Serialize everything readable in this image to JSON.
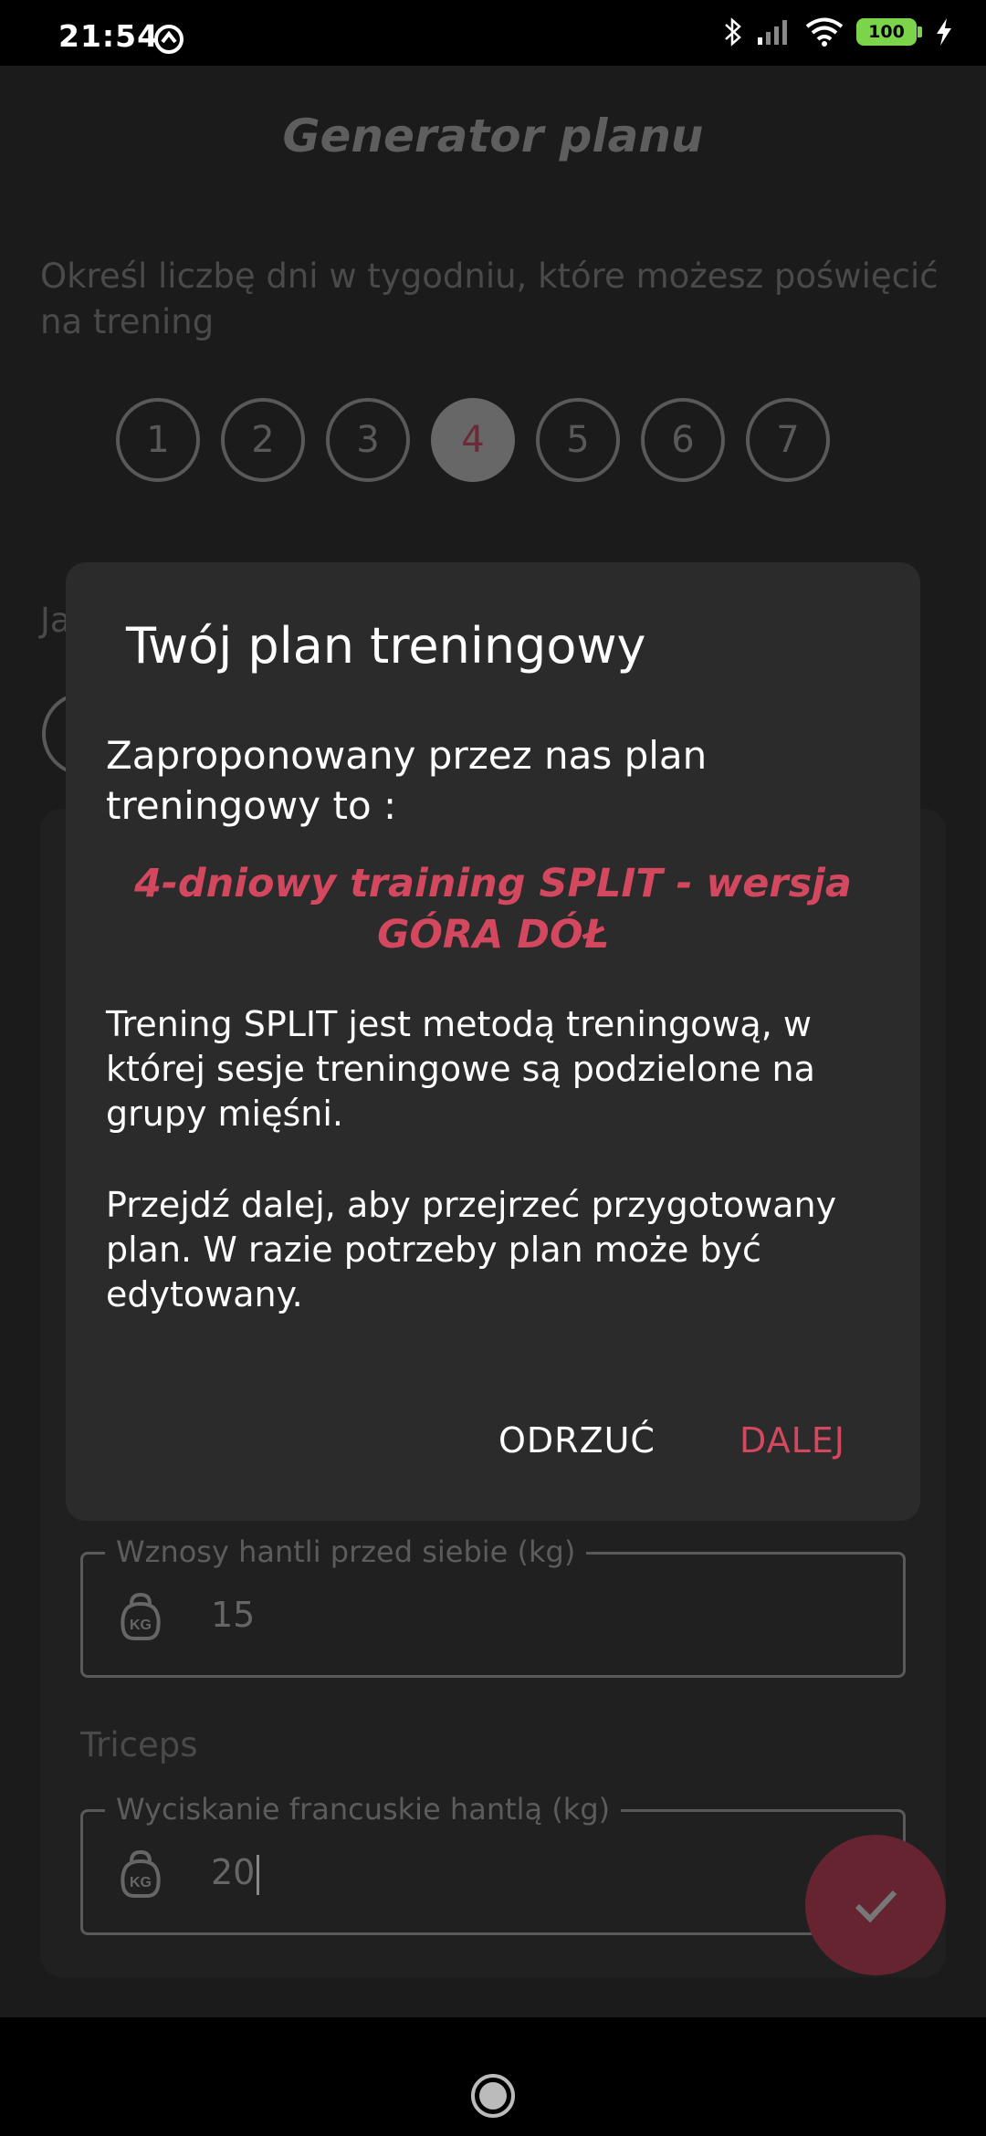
{
  "status_bar": {
    "time": "21:54",
    "battery": "100",
    "icons": [
      "app-notification-icon",
      "bluetooth-icon",
      "signal-icon",
      "wifi-icon",
      "battery-icon",
      "charging-icon"
    ]
  },
  "page": {
    "title": "Generator planu",
    "description": "Określ liczbę dni w tygodniu, które możesz poświęcić na trening",
    "days": [
      "1",
      "2",
      "3",
      "4",
      "5",
      "6",
      "7"
    ],
    "selected_day": "4",
    "peek_label": "Ja"
  },
  "form": {
    "field1": {
      "label": "Wznosy hantli przed siebie (kg)",
      "value": "15"
    },
    "section_label": "Triceps",
    "field2": {
      "label": "Wyciskanie francuskie hantlą (kg)",
      "value": "20"
    }
  },
  "dialog": {
    "title": "Twój plan treningowy",
    "intro": "Zaproponowany przez nas plan treningowy to :",
    "plan_name": "4-dniowy training SPLIT - wersja GÓRA DÓŁ",
    "explanation": "Trening SPLIT jest metodą treningową, w której sesje treningowe są podzielone na grupy mięśni.",
    "next_info": "Przejdź dalej, aby przejrzeć przygotowany plan. W razie potrzeby plan może być edytowany.",
    "reject_label": "ODRZUĆ",
    "next_label": "DALEJ"
  },
  "colors": {
    "accent": "#d4485f",
    "dialog_bg": "#2b2b2b",
    "fab_dimmed": "#652430"
  }
}
